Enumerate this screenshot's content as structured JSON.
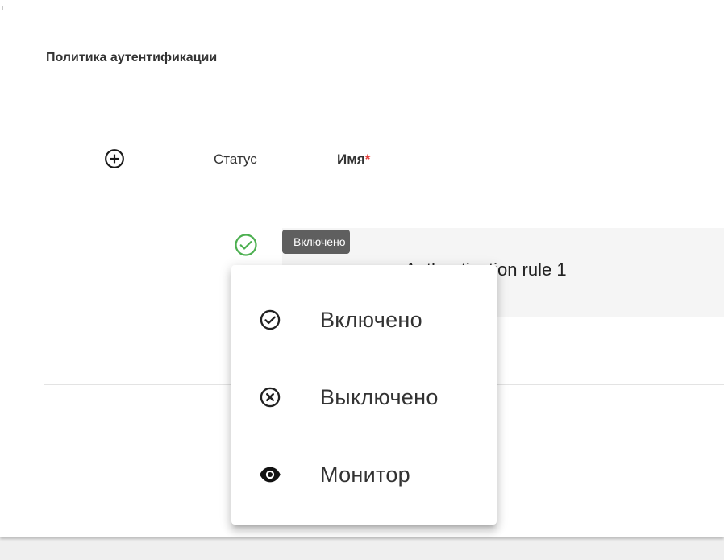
{
  "section": {
    "title": "Политика аутентификации"
  },
  "table": {
    "columns": {
      "status": "Статус",
      "name": "Имя",
      "required_mark": "*"
    },
    "add_icon": "plus-circle-icon"
  },
  "row": {
    "status_icon": "check-circle-icon",
    "status_color": "#4caf50",
    "name_value": "Authentication rule 1",
    "tooltip": "Включено"
  },
  "status_menu": {
    "items": [
      {
        "label": "Включено",
        "icon": "check-circle-outline-icon"
      },
      {
        "label": "Выключено",
        "icon": "close-circle-outline-icon"
      },
      {
        "label": "Монитор",
        "icon": "eye-icon"
      }
    ]
  }
}
